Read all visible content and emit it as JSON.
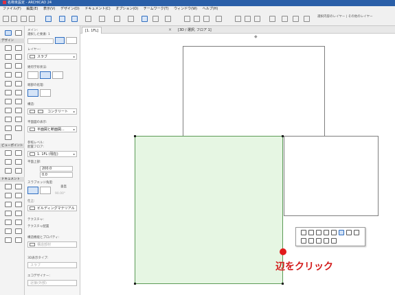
{
  "window": {
    "title": "名称未設定 - ARCHICAD 24"
  },
  "menu": [
    "ファイル(F)",
    "編集(E)",
    "表示(V)",
    "デザイン(D)",
    "ドキュメント(C)",
    "オプション(O)",
    "チームワーク(T)",
    "ウィンドウ(W)",
    "ヘルプ(H)"
  ],
  "toolbar": {
    "right_label": "選択内容のレイヤー | その他のレイヤー"
  },
  "tabs": [
    {
      "label": "[1. 1FL]",
      "active": true
    },
    {
      "label": "[3D / 選択, フロア 1]",
      "active": false
    }
  ],
  "toolbox": {
    "sections": [
      "デザイン",
      "ビューポイント",
      "ドキュメント"
    ]
  },
  "infobox": {
    "main_label": "メイン:",
    "selected_count": "選択した要素: 1",
    "layer_label": "レイヤー:",
    "layer_value": "スラブ",
    "geometry_label": "幾何学形状法:",
    "edge_label": "端部の処理:",
    "structure_label": "構造:",
    "structure_value": "コンクリート",
    "plan_label": "平面図の表示:",
    "plan_value": "平面図と断面図...",
    "ref_label": "参照レベル:",
    "home_story_label": "配置フロア:",
    "home_story_value": "1. 1FL (現在)",
    "top_label": "平面上部:",
    "top_value": "200.0",
    "offset_value": "0.0",
    "slab_thickness_label": "スラブエッジ角度:",
    "vertical_label": "垂直",
    "angle_value": "90.00°",
    "surface_label": "仕上:",
    "surface_value": "ビルディングマテリアル",
    "texture_label": "テクスチャ:",
    "texture_value": "テクスチャ配置",
    "classification_label": "構造機能とプロパティ:",
    "classification_value": "構造部材",
    "renovation_label": "3D表示タイプ:",
    "renovation_value": "スラブ",
    "eco_label": "エコデザイナー:",
    "eco_value": "近接(外部)"
  },
  "annotation": {
    "callout_text": "辺をクリック",
    "callout_color": "#d31a1a",
    "dot_color": "#e11b1b"
  },
  "colors": {
    "slab_fill": "#e6f6e3",
    "slab_border": "#5a9a55",
    "accent": "#2d6cbf",
    "titlebar": "#2a5fa8"
  }
}
